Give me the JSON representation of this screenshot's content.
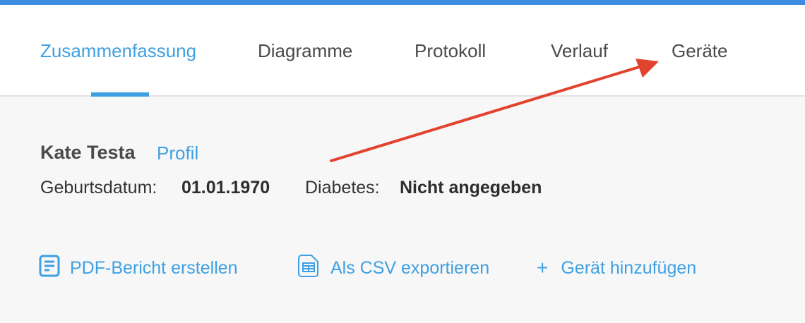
{
  "tabs": [
    {
      "label": "Zusammenfassung",
      "active": true
    },
    {
      "label": "Diagramme",
      "active": false
    },
    {
      "label": "Protokoll",
      "active": false
    },
    {
      "label": "Verlauf",
      "active": false
    },
    {
      "label": "Geräte",
      "active": false
    }
  ],
  "patient": {
    "name": "Kate Testa",
    "profile_link": "Profil",
    "birth_label": "Geburtsdatum:",
    "birth_value": "01.01.1970",
    "diabetes_label": "Diabetes:",
    "diabetes_value": "Nicht angegeben"
  },
  "actions": {
    "pdf_report": "PDF-Bericht erstellen",
    "csv_export": "Als CSV exportieren",
    "add_device": "Gerät hinzufügen"
  },
  "colors": {
    "accent": "#3ea0e2",
    "top_bar": "#3d8de3",
    "annotation_arrow": "#e2432f"
  },
  "icons": {
    "pdf": "document-icon",
    "csv": "table-file-icon",
    "add": "plus-icon"
  }
}
